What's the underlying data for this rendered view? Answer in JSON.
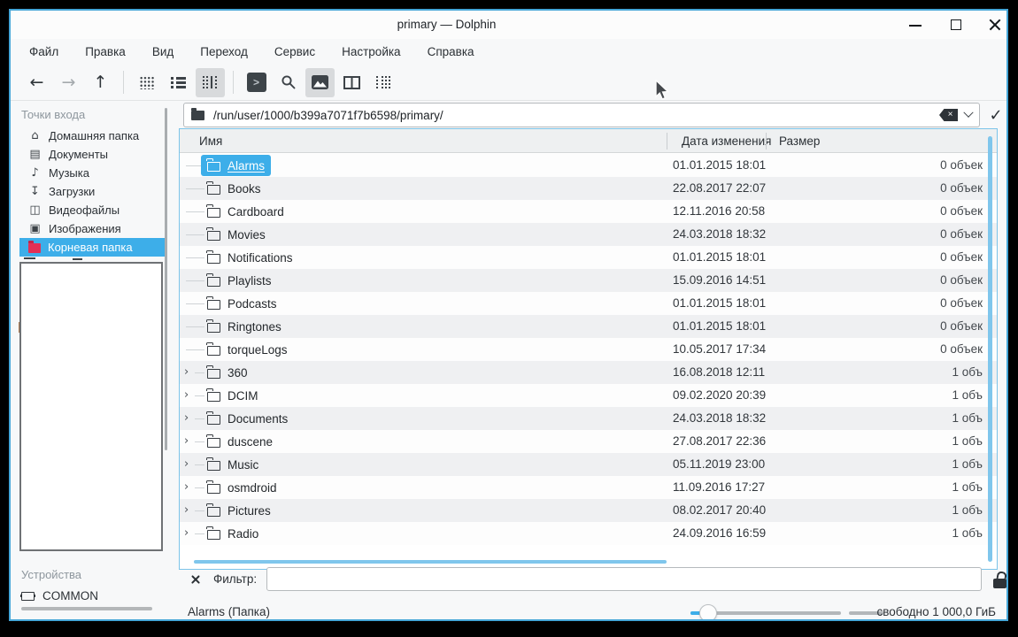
{
  "colors": {
    "accent": "#3daee9",
    "root_folder_red": "#e22f55",
    "scrollbar_blue": "#7fc6ec",
    "window_border": "#45a6d8"
  },
  "window": {
    "title": "primary — Dolphin"
  },
  "menubar": {
    "items": [
      {
        "label": "Файл"
      },
      {
        "label": "Правка"
      },
      {
        "label": "Вид"
      },
      {
        "label": "Переход"
      },
      {
        "label": "Сервис"
      },
      {
        "label": "Настройка"
      },
      {
        "label": "Справка"
      }
    ]
  },
  "toolbar": {
    "buttons": [
      "back",
      "forward",
      "up",
      "icons-view",
      "compact-view",
      "details-view",
      "terminal",
      "search",
      "preview",
      "split-view",
      "panels"
    ]
  },
  "location": {
    "path": "/run/user/1000/b399a7071f7b6598/primary/"
  },
  "places": {
    "header": "Точки входа",
    "items": [
      {
        "label": "Домашняя папка",
        "icon": "home"
      },
      {
        "label": "Документы",
        "icon": "documents"
      },
      {
        "label": "Музыка",
        "icon": "music"
      },
      {
        "label": "Загрузки",
        "icon": "downloads"
      },
      {
        "label": "Видеофайлы",
        "icon": "videos"
      },
      {
        "label": "Изображения",
        "icon": "images"
      },
      {
        "label": "Корневая папка",
        "icon": "root-folder",
        "selected": true
      }
    ]
  },
  "devices": {
    "header": "Устройства",
    "items": [
      {
        "label": "COMMON",
        "icon": "device"
      }
    ]
  },
  "list": {
    "columns": [
      {
        "label": "Имя"
      },
      {
        "label": "Дата изменения"
      },
      {
        "label": "Размер"
      }
    ],
    "rows": [
      {
        "name": "Alarms",
        "date": "01.01.2015 18:01",
        "size": "0 объек",
        "selected": true
      },
      {
        "name": "Books",
        "date": "22.08.2017 22:07",
        "size": "0 объек"
      },
      {
        "name": "Cardboard",
        "date": "12.11.2016 20:58",
        "size": "0 объек"
      },
      {
        "name": "Movies",
        "date": "24.03.2018 18:32",
        "size": "0 объек"
      },
      {
        "name": "Notifications",
        "date": "01.01.2015 18:01",
        "size": "0 объек"
      },
      {
        "name": "Playlists",
        "date": "15.09.2016 14:51",
        "size": "0 объек"
      },
      {
        "name": "Podcasts",
        "date": "01.01.2015 18:01",
        "size": "0 объек"
      },
      {
        "name": "Ringtones",
        "date": "01.01.2015 18:01",
        "size": "0 объек"
      },
      {
        "name": "torqueLogs",
        "date": "10.05.2017 17:34",
        "size": "0 объек"
      },
      {
        "name": "360",
        "date": "16.08.2018 12:11",
        "size": "1 объ",
        "expandable": true
      },
      {
        "name": "DCIM",
        "date": "09.02.2020 20:39",
        "size": "1 объ",
        "expandable": true
      },
      {
        "name": "Documents",
        "date": "24.03.2018 18:32",
        "size": "1 объ",
        "expandable": true
      },
      {
        "name": "duscene",
        "date": "27.08.2017 22:36",
        "size": "1 объ",
        "expandable": true
      },
      {
        "name": "Music",
        "date": "05.11.2019 23:00",
        "size": "1 объ",
        "expandable": true
      },
      {
        "name": "osmdroid",
        "date": "11.09.2016 17:27",
        "size": "1 объ",
        "expandable": true
      },
      {
        "name": "Pictures",
        "date": "08.02.2017 20:40",
        "size": "1 объ",
        "expandable": true
      },
      {
        "name": "Radio",
        "date": "24.09.2016 16:59",
        "size": "1 объ",
        "expandable": true
      }
    ]
  },
  "filter": {
    "label": "Фильтр:",
    "value": ""
  },
  "status": {
    "selection": "Alarms (Папка)",
    "free_space": "свободно 1 000,0 ГиБ"
  }
}
